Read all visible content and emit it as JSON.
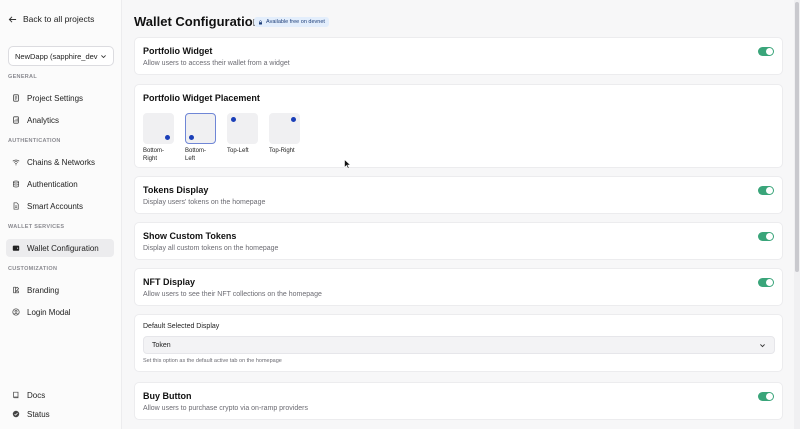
{
  "sidebar": {
    "back_label": "Back to all projects",
    "project": "NewDapp (sapphire_dev",
    "sections": [
      {
        "label": "GENERAL",
        "items": [
          {
            "label": "Project Settings",
            "icon": "document-icon"
          },
          {
            "label": "Analytics",
            "icon": "report-icon"
          }
        ]
      },
      {
        "label": "AUTHENTICATION",
        "items": [
          {
            "label": "Chains & Networks",
            "icon": "wifi-icon"
          },
          {
            "label": "Authentication",
            "icon": "database-icon"
          },
          {
            "label": "Smart Accounts",
            "icon": "file-icon"
          }
        ]
      },
      {
        "label": "WALLET SERVICES",
        "items": [
          {
            "label": "Wallet Configuration",
            "icon": "wallet-icon",
            "active": true
          }
        ]
      },
      {
        "label": "CUSTOMIZATION",
        "items": [
          {
            "label": "Branding",
            "icon": "palette-icon"
          },
          {
            "label": "Login Modal",
            "icon": "user-circle-icon"
          }
        ]
      }
    ],
    "footer": [
      {
        "label": "Docs",
        "icon": "book-icon"
      },
      {
        "label": "Status",
        "icon": "check-circle-icon"
      }
    ]
  },
  "header": {
    "title": "Wallet Configuration",
    "badge": "Available free on devnet"
  },
  "cards": {
    "portfolio": {
      "title": "Portfolio Widget",
      "desc": "Allow users to access their wallet from a widget",
      "enabled": true
    },
    "placement": {
      "title": "Portfolio Widget Placement",
      "options": [
        {
          "label": "Bottom-Right",
          "selected": false
        },
        {
          "label": "Bottom-Left",
          "selected": true
        },
        {
          "label": "Top-Left",
          "selected": false
        },
        {
          "label": "Top-Right",
          "selected": false
        }
      ]
    },
    "tokens": {
      "title": "Tokens Display",
      "desc": "Display users' tokens on the homepage",
      "enabled": true
    },
    "custom_tokens": {
      "title": "Show Custom Tokens",
      "desc": "Display all custom tokens on the homepage",
      "enabled": true
    },
    "nft": {
      "title": "NFT Display",
      "desc": "Allow users to see their NFT collections on the homepage",
      "enabled": true
    },
    "default_display": {
      "label": "Default Selected Display",
      "value": "Token",
      "hint": "Set this option as the default active tab on the homepage"
    },
    "buy": {
      "title": "Buy Button",
      "desc": "Allow users to purchase crypto via on-ramp providers",
      "enabled": true
    }
  },
  "colors": {
    "toggle_on": "#3aa57a",
    "accent_dot": "#1b3fb8",
    "badge_bg": "#e3eefc"
  }
}
